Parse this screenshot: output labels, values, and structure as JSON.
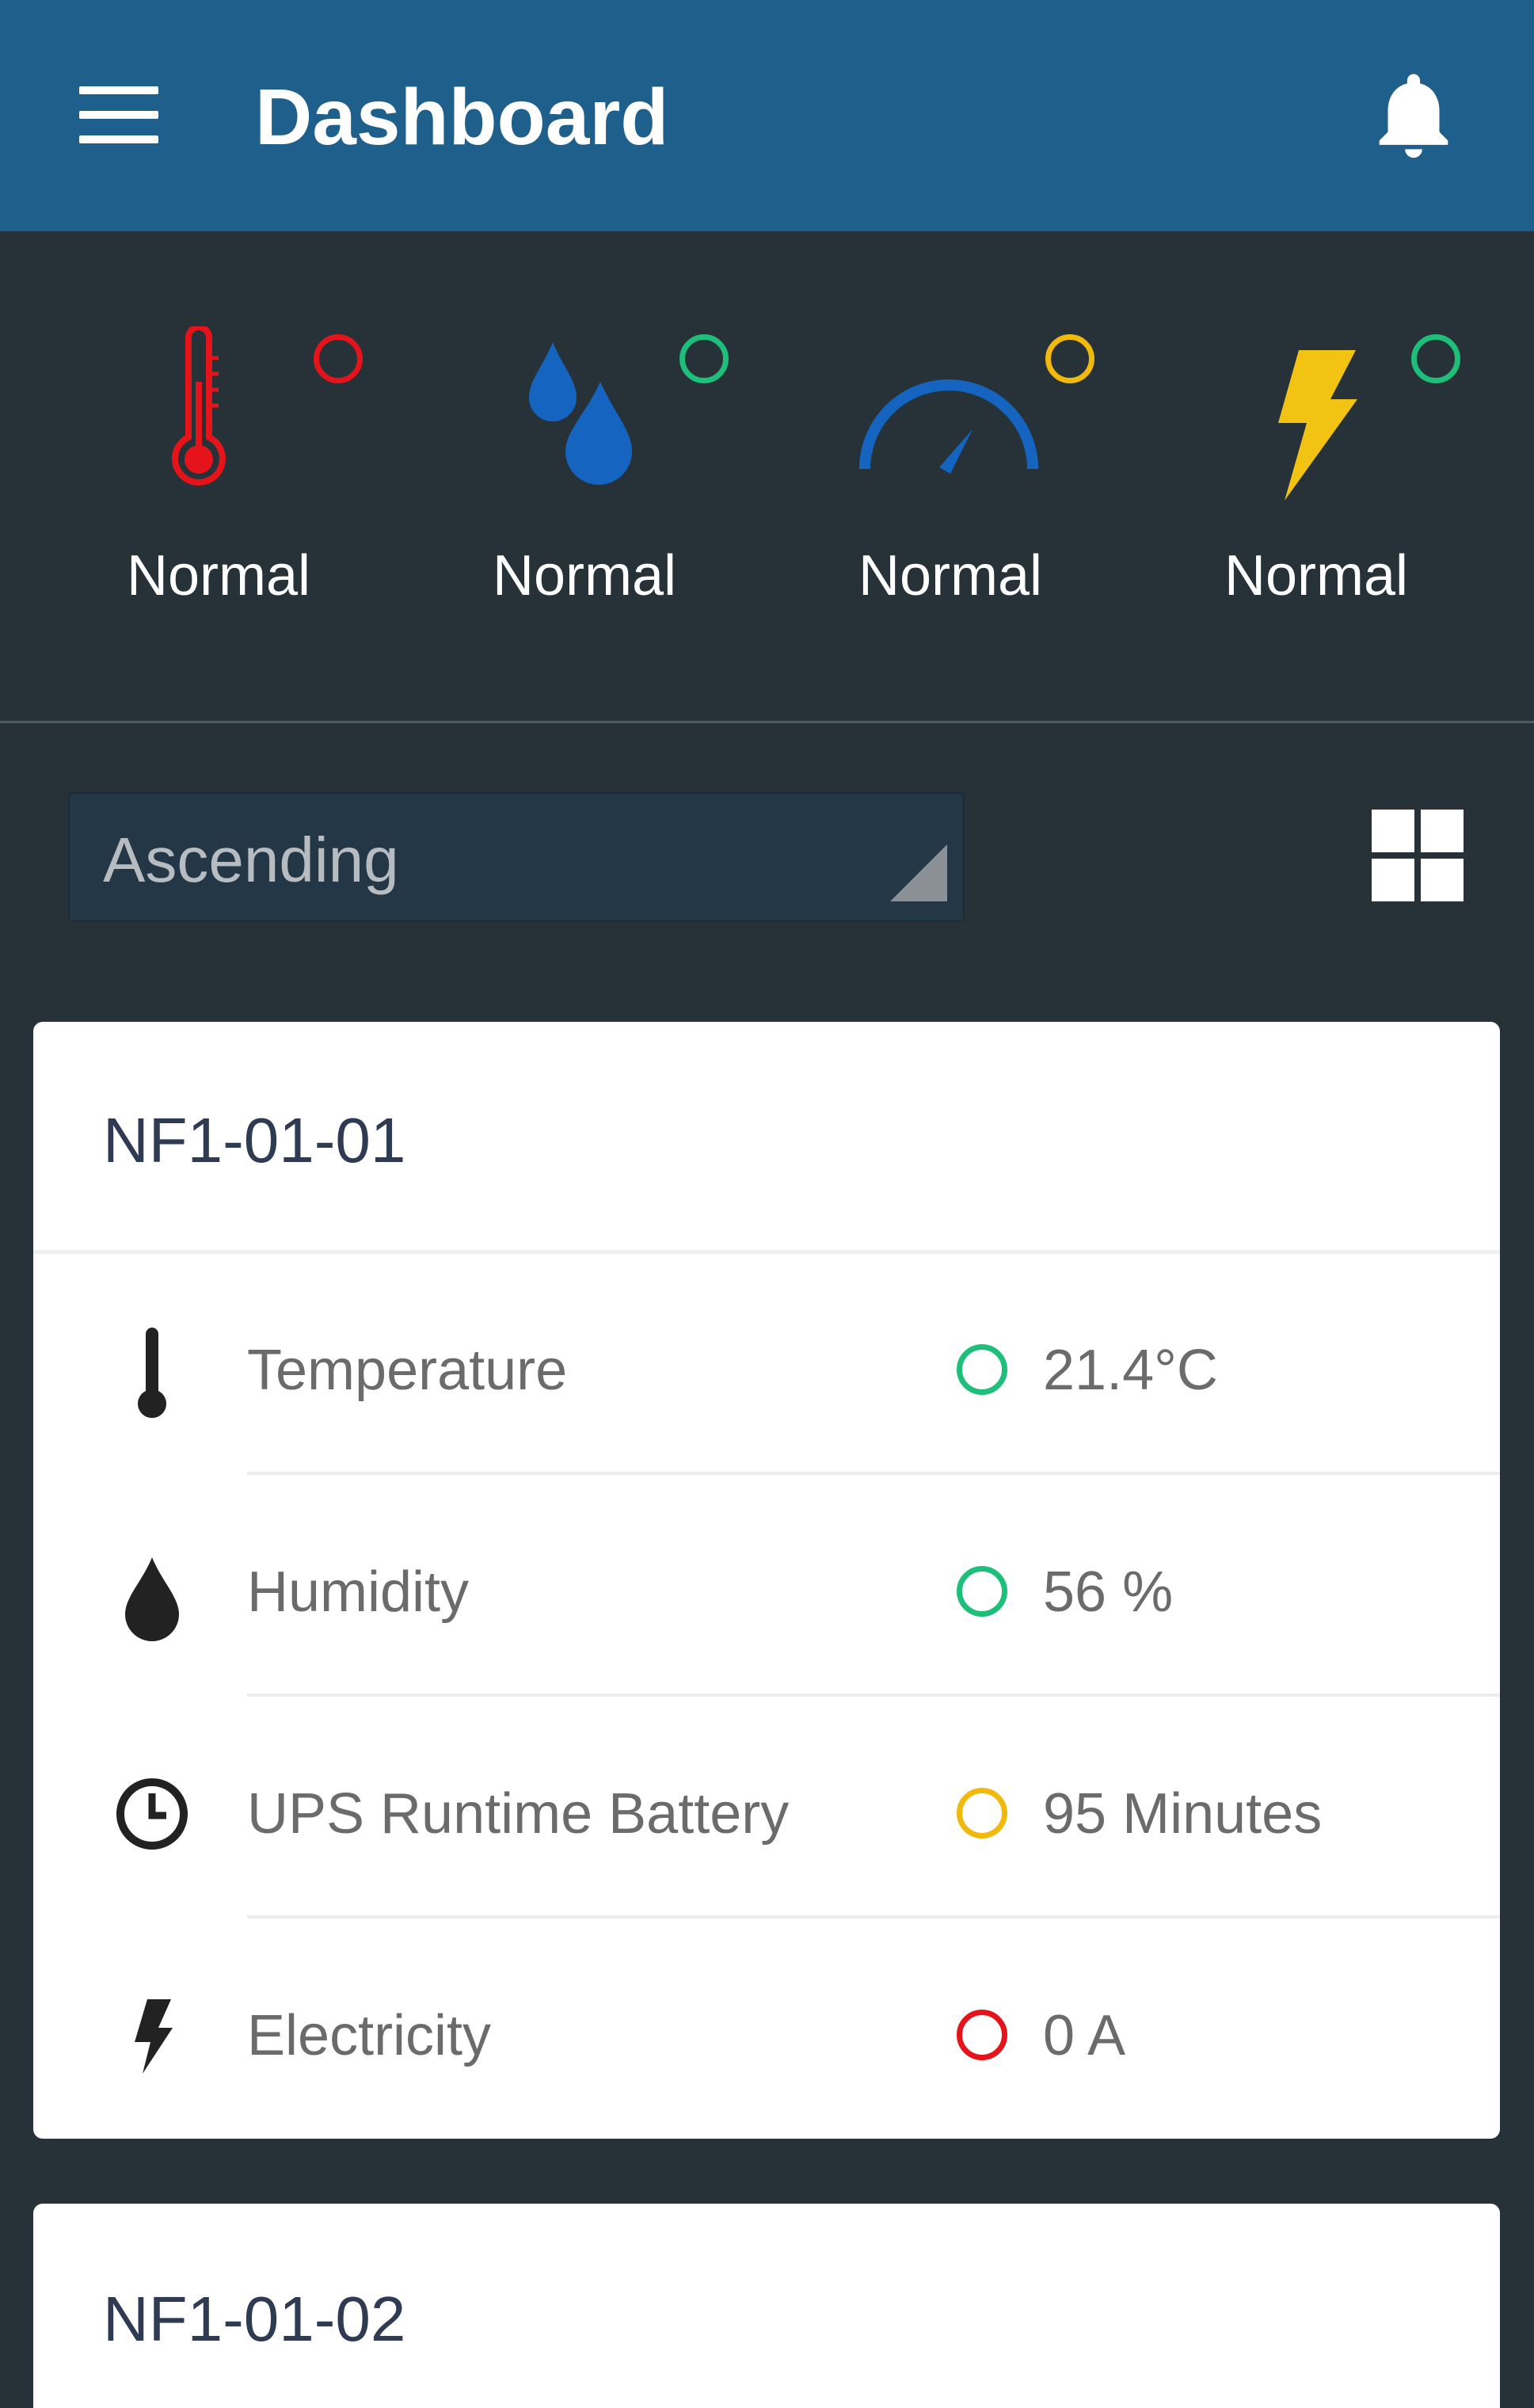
{
  "appbar": {
    "title": "Dashboard",
    "menu_icon": "hamburger-menu-icon",
    "bell_icon": "bell-icon"
  },
  "status": [
    {
      "icon": "thermometer-icon",
      "label": "Normal",
      "dot_color": "#e5141b",
      "icon_color": "#e5141b"
    },
    {
      "icon": "water-drops-icon",
      "label": "Normal",
      "dot_color": "#1dbf7a",
      "icon_color": "#1565c0"
    },
    {
      "icon": "gauge-icon",
      "label": "Normal",
      "dot_color": "#f0b90b",
      "icon_color": "#1565c0"
    },
    {
      "icon": "lightning-icon",
      "label": "Normal",
      "dot_color": "#1dbf7a",
      "icon_color": "#f3c314"
    }
  ],
  "sort": {
    "value": "Ascending"
  },
  "cards": [
    {
      "title": "NF1-01-01",
      "rows": [
        {
          "icon": "thermometer-icon",
          "label": "Temperature",
          "value": "21.4°C",
          "dot_color": "#1dbf7a"
        },
        {
          "icon": "water-drop-icon",
          "label": "Humidity",
          "value": "56 %",
          "dot_color": "#1dbf7a"
        },
        {
          "icon": "clock-icon",
          "label": "UPS Runtime Battery",
          "value": "95 Minutes",
          "dot_color": "#f0b90b"
        },
        {
          "icon": "lightning-icon",
          "label": "Electricity",
          "value": "0 A",
          "dot_color": "#e5141b"
        }
      ]
    },
    {
      "title": "NF1-01-02"
    }
  ]
}
